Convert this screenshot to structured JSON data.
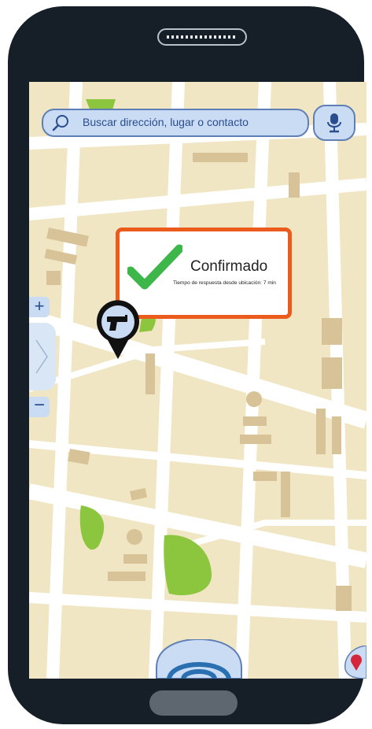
{
  "search": {
    "placeholder": "Buscar dirección, lugar o contacto"
  },
  "confirmation": {
    "title": "Confirmado",
    "subtitle": "Tiempo de respuesta desde ubicación: 7 min"
  },
  "zoom": {
    "in_label": "+",
    "out_label": "−"
  },
  "colors": {
    "accent_border": "#ea5b1c",
    "check_green": "#3db64a",
    "map_bg": "#f7f3e5",
    "road": "#ffffff",
    "block": "#f0e6c4",
    "park": "#8cc63f",
    "ui_blue": "#c9dcf3"
  },
  "icons": [
    "search-icon",
    "microphone-icon",
    "check-icon",
    "gun-icon",
    "chevron-right-icon",
    "location-marker-icon",
    "signal-icon"
  ]
}
